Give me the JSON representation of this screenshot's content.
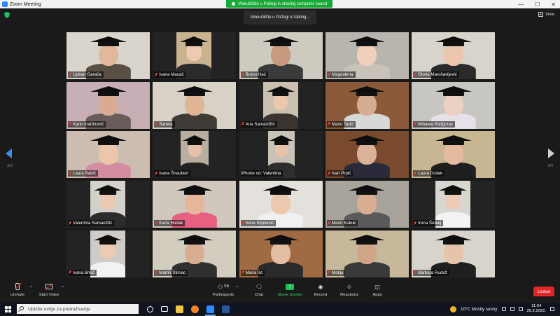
{
  "window": {
    "title": "Zoom Meeting",
    "controls": [
      "—",
      "☐",
      "✕"
    ]
  },
  "share_banner": {
    "text": "Veleučilište u Požegi is sharing computer sound"
  },
  "speaker_notice": {
    "text": "Veleučilište u Požegi is talking..."
  },
  "view_button": {
    "label": "View"
  },
  "pagination": {
    "left": "3/3",
    "right": "3/3"
  },
  "participants": [
    {
      "name": "Ljuban Garača",
      "muted": true,
      "bg": "#d9d4cc",
      "skin": "#e2b89c",
      "body": "#5a4f45",
      "cap": true,
      "vx": 0,
      "vw": 119
    },
    {
      "name": "Ivana Macaš",
      "muted": true,
      "bg": "#c9b28f",
      "skin": "#eccbb2",
      "body": "#2b2b2b",
      "cap": true,
      "vx": 34,
      "vw": 50
    },
    {
      "name": "Bruno Hać",
      "muted": true,
      "bg": "#cfcabf",
      "skin": "#c89a7e",
      "body": "#3a3a3a",
      "cap": true,
      "vx": 0,
      "vw": 119
    },
    {
      "name": "Magdalena",
      "muted": true,
      "bg": "#b8b4ae",
      "skin": "#f0d0bb",
      "body": "#c9c2b8",
      "cap": true,
      "vx": 0,
      "vw": 119
    },
    {
      "name": "Gloria Marošavljević",
      "muted": true,
      "bg": "#d8d4cb",
      "skin": "#ecc6ad",
      "body": "#2a2a2a",
      "cap": true,
      "vx": 0,
      "vw": 119
    },
    {
      "name": "Karlo martinović",
      "muted": true,
      "bg": "#c7afb5",
      "skin": "#d8ab92",
      "body": "#6a5c5a",
      "cap": true,
      "vx": 0,
      "vw": 119
    },
    {
      "name": "Sanela",
      "muted": true,
      "bg": "#d8d2c6",
      "skin": "#dfb596",
      "body": "#3e3a36",
      "cap": true,
      "vx": 0,
      "vw": 119
    },
    {
      "name": "Ana Samardžić",
      "muted": true,
      "bg": "#cbbfb0",
      "skin": "#ecc7ad",
      "body": "#3a3430",
      "cap": true,
      "vx": 34,
      "vw": 50
    },
    {
      "name": "Mario Tadić",
      "muted": true,
      "bg": "#8a5a3a",
      "skin": "#d7ac92",
      "body": "#d8d8d8",
      "cap": true,
      "vx": 0,
      "vw": 119
    },
    {
      "name": "Mihaela Podgorac",
      "muted": true,
      "bg": "#c8c6c2",
      "skin": "#ecd0c2",
      "body": "#e6e0e8",
      "cap": true,
      "vx": 0,
      "vw": 119
    },
    {
      "name": "Laura Babić",
      "muted": true,
      "bg": "#cdbdb0",
      "skin": "#ecc6ab",
      "body": "#d28ea0",
      "cap": true,
      "vx": 0,
      "vw": 119
    },
    {
      "name": "Ivana Šnaubert",
      "muted": true,
      "bg": "#b9ae9f",
      "skin": "#e6c0a8",
      "body": "#222222",
      "cap": true,
      "vx": 40,
      "vw": 40
    },
    {
      "name": "iPhone od: Valentina",
      "muted": false,
      "bg": "#c9c2b6",
      "skin": "#e8c3aa",
      "body": "#2e2e2e",
      "cap": true,
      "vx": 41,
      "vw": 38
    },
    {
      "name": "Ivan Prpić",
      "muted": true,
      "bg": "#7a4a2e",
      "skin": "#dbb197",
      "body": "#2a2a3a",
      "cap": true,
      "vx": 0,
      "vw": 119
    },
    {
      "name": "Laura Dušek",
      "muted": true,
      "bg": "#c7b691",
      "skin": "#e4bb9f",
      "body": "#1f1f1f",
      "cap": true,
      "vx": 0,
      "vw": 119
    },
    {
      "name": "Valentina Samardžić",
      "muted": true,
      "bg": "#d4d0cb",
      "skin": "#eccab1",
      "body": "#2b2b2b",
      "cap": true,
      "vx": 34,
      "vw": 50
    },
    {
      "name": "Karla Hodak",
      "muted": true,
      "bg": "#d0c8bc",
      "skin": "#e6b69b",
      "body": "#e86080",
      "cap": true,
      "vx": 0,
      "vw": 119
    },
    {
      "name": "Irena Stipčević",
      "muted": true,
      "bg": "#e4e1dc",
      "skin": "#ecc8ae",
      "body": "#f0f0f0",
      "cap": true,
      "vx": 0,
      "vw": 119
    },
    {
      "name": "Marin Kukuk",
      "muted": true,
      "bg": "#a8a39b",
      "skin": "#d8ad92",
      "body": "#5a5a5a",
      "cap": true,
      "vx": 0,
      "vw": 119
    },
    {
      "name": "Irena Šebalj",
      "muted": true,
      "bg": "#d8d6d0",
      "skin": "#eccab3",
      "body": "#f3f3f3",
      "cap": true,
      "vx": 34,
      "vw": 50
    },
    {
      "name": "Ivana Brkić",
      "muted": true,
      "bg": "#cfccc7",
      "skin": "#eccbb2",
      "body": "#f2f2f2",
      "cap": true,
      "vx": 34,
      "vw": 50
    },
    {
      "name": "Martin Štimac",
      "muted": true,
      "bg": "#d3cdc0",
      "skin": "#d8ad92",
      "body": "#303030",
      "cap": true,
      "vx": 0,
      "vw": 119
    },
    {
      "name": "Maria Ilić",
      "muted": true,
      "bg": "#a06a42",
      "skin": "#e4bea3",
      "body": "#2a2a2a",
      "cap": true,
      "vx": 0,
      "vw": 119
    },
    {
      "name": "Matija",
      "muted": true,
      "bg": "#c8b89b",
      "skin": "#cfa487",
      "body": "#3a3a3a",
      "cap": true,
      "vx": 0,
      "vw": 119
    },
    {
      "name": "Barbara Rudež",
      "muted": true,
      "bg": "#d8d4cc",
      "skin": "#e6c3aa",
      "body": "#1f1f1f",
      "cap": true,
      "vx": 0,
      "vw": 119
    }
  ],
  "toolbar": {
    "unmute": "Unmute",
    "start_video": "Start Video",
    "participants": "Participants",
    "participants_count": "58",
    "chat": "Chat",
    "share_screen": "Share Screen",
    "record": "Record",
    "reactions": "Reactions",
    "apps": "Apps",
    "leave": "Leave"
  },
  "taskbar": {
    "search_placeholder": "Upišite ovdje za pretraživanje",
    "weather": "10°C Mostly sunny",
    "time": "11:04",
    "date": "25.2.2022."
  },
  "colors": {
    "accent": "#2d8cff",
    "share_green": "#17a936",
    "leave_red": "#e02828",
    "muted_red": "#e8413a"
  }
}
